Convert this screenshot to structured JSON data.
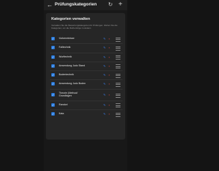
{
  "appbar": {
    "back_icon": "arrow-left-icon",
    "title": "Prüfungskategorien",
    "refresh_icon": "refresh-icon",
    "add_icon": "plus-icon"
  },
  "card": {
    "title": "Kategorien verwalten",
    "description": "Verwalten Sie die Bewertungskategorien für Prüfungen. Ziehen Sie die Kategorien, um die Reihenfolge zu ändern."
  },
  "categories": [
    {
      "label": "Vorkenntnisse",
      "checked": true
    },
    {
      "label": "Falltechnik",
      "checked": true
    },
    {
      "label": "Wurftechnik",
      "checked": true
    },
    {
      "label": "Anwendung Judo Stand",
      "checked": true
    },
    {
      "label": "Bodentechnik",
      "checked": true
    },
    {
      "label": "Anwendung Judo Boden",
      "checked": true
    },
    {
      "label": "Theorie (Method/\nGrundlagen",
      "checked": true
    },
    {
      "label": "Randori",
      "checked": true
    },
    {
      "label": "Kata",
      "checked": true
    }
  ],
  "colors": {
    "accent": "#2a7de1",
    "edit": "#3b82f6",
    "delete": "#e0453b",
    "background": "#181818",
    "card": "#262626"
  }
}
